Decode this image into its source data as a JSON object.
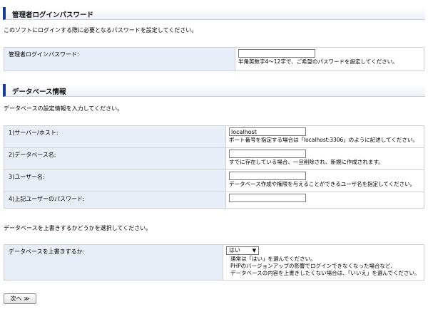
{
  "admin": {
    "title": "管理者ログインパスワード",
    "intro": "このソフトにログインする際に必要となるパスワードを設定してください。",
    "password_label": "管理者ログインパスワード:",
    "password_value": "",
    "password_hint": "半角英数字4〜12字で、ご希望のパスワードを設定してください。"
  },
  "database": {
    "title": "データベース情報",
    "intro": "データベースの設定情報を入力してください。",
    "fields": [
      {
        "label": "1)サーバー/ホスト:",
        "value": "localhost",
        "hint": "ポート番号を指定する場合は「localhost:3306」のように記述してください。"
      },
      {
        "label": "2)データベース名:",
        "value": "",
        "hint": "すでに存在している場合、一旦削除され、新規に作成されます。"
      },
      {
        "label": "3)ユーザー名:",
        "value": "",
        "hint": "データベース作成や権限を与えることができるユーザ名を指定してください。"
      },
      {
        "label": "4)上記ユーザーのパスワード:",
        "value": "",
        "hint": ""
      }
    ]
  },
  "overwrite": {
    "intro": "データベースを上書きするかどうかを選択してください。",
    "label": "データベースを上書きするか:",
    "selected": "はい",
    "hint_lines": [
      "通常は「はい」を選んでください。",
      "PHPのバージョンアップの影響でログインできなくなった場合など、",
      "データベースの内容を上書きしたくない場合は、「いいえ」を選んでください。"
    ]
  },
  "next_button": "次へ ≫"
}
